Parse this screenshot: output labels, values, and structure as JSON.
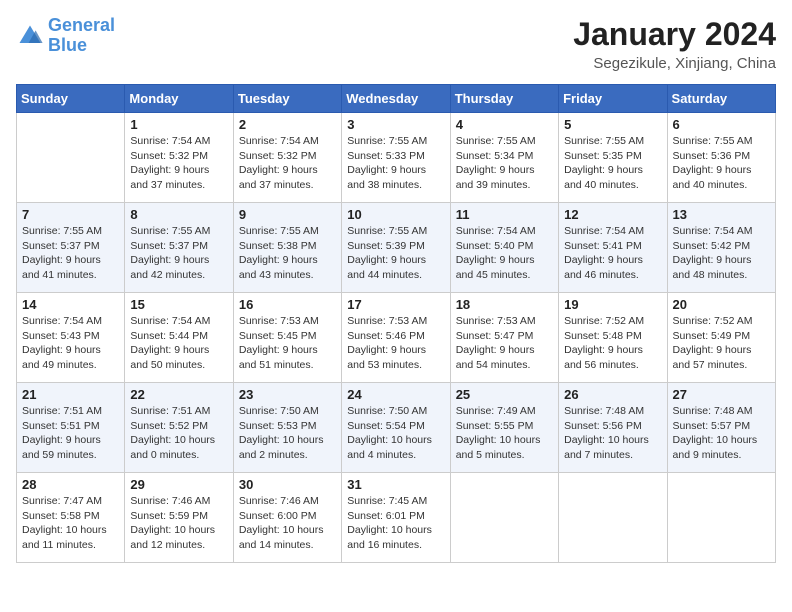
{
  "logo": {
    "line1": "General",
    "line2": "Blue"
  },
  "title": "January 2024",
  "subtitle": "Segezikule, Xinjiang, China",
  "weekdays": [
    "Sunday",
    "Monday",
    "Tuesday",
    "Wednesday",
    "Thursday",
    "Friday",
    "Saturday"
  ],
  "weeks": [
    [
      {
        "day": "",
        "info": ""
      },
      {
        "day": "1",
        "info": "Sunrise: 7:54 AM\nSunset: 5:32 PM\nDaylight: 9 hours\nand 37 minutes."
      },
      {
        "day": "2",
        "info": "Sunrise: 7:54 AM\nSunset: 5:32 PM\nDaylight: 9 hours\nand 37 minutes."
      },
      {
        "day": "3",
        "info": "Sunrise: 7:55 AM\nSunset: 5:33 PM\nDaylight: 9 hours\nand 38 minutes."
      },
      {
        "day": "4",
        "info": "Sunrise: 7:55 AM\nSunset: 5:34 PM\nDaylight: 9 hours\nand 39 minutes."
      },
      {
        "day": "5",
        "info": "Sunrise: 7:55 AM\nSunset: 5:35 PM\nDaylight: 9 hours\nand 40 minutes."
      },
      {
        "day": "6",
        "info": "Sunrise: 7:55 AM\nSunset: 5:36 PM\nDaylight: 9 hours\nand 40 minutes."
      }
    ],
    [
      {
        "day": "7",
        "info": "Sunrise: 7:55 AM\nSunset: 5:37 PM\nDaylight: 9 hours\nand 41 minutes."
      },
      {
        "day": "8",
        "info": "Sunrise: 7:55 AM\nSunset: 5:37 PM\nDaylight: 9 hours\nand 42 minutes."
      },
      {
        "day": "9",
        "info": "Sunrise: 7:55 AM\nSunset: 5:38 PM\nDaylight: 9 hours\nand 43 minutes."
      },
      {
        "day": "10",
        "info": "Sunrise: 7:55 AM\nSunset: 5:39 PM\nDaylight: 9 hours\nand 44 minutes."
      },
      {
        "day": "11",
        "info": "Sunrise: 7:54 AM\nSunset: 5:40 PM\nDaylight: 9 hours\nand 45 minutes."
      },
      {
        "day": "12",
        "info": "Sunrise: 7:54 AM\nSunset: 5:41 PM\nDaylight: 9 hours\nand 46 minutes."
      },
      {
        "day": "13",
        "info": "Sunrise: 7:54 AM\nSunset: 5:42 PM\nDaylight: 9 hours\nand 48 minutes."
      }
    ],
    [
      {
        "day": "14",
        "info": "Sunrise: 7:54 AM\nSunset: 5:43 PM\nDaylight: 9 hours\nand 49 minutes."
      },
      {
        "day": "15",
        "info": "Sunrise: 7:54 AM\nSunset: 5:44 PM\nDaylight: 9 hours\nand 50 minutes."
      },
      {
        "day": "16",
        "info": "Sunrise: 7:53 AM\nSunset: 5:45 PM\nDaylight: 9 hours\nand 51 minutes."
      },
      {
        "day": "17",
        "info": "Sunrise: 7:53 AM\nSunset: 5:46 PM\nDaylight: 9 hours\nand 53 minutes."
      },
      {
        "day": "18",
        "info": "Sunrise: 7:53 AM\nSunset: 5:47 PM\nDaylight: 9 hours\nand 54 minutes."
      },
      {
        "day": "19",
        "info": "Sunrise: 7:52 AM\nSunset: 5:48 PM\nDaylight: 9 hours\nand 56 minutes."
      },
      {
        "day": "20",
        "info": "Sunrise: 7:52 AM\nSunset: 5:49 PM\nDaylight: 9 hours\nand 57 minutes."
      }
    ],
    [
      {
        "day": "21",
        "info": "Sunrise: 7:51 AM\nSunset: 5:51 PM\nDaylight: 9 hours\nand 59 minutes."
      },
      {
        "day": "22",
        "info": "Sunrise: 7:51 AM\nSunset: 5:52 PM\nDaylight: 10 hours\nand 0 minutes."
      },
      {
        "day": "23",
        "info": "Sunrise: 7:50 AM\nSunset: 5:53 PM\nDaylight: 10 hours\nand 2 minutes."
      },
      {
        "day": "24",
        "info": "Sunrise: 7:50 AM\nSunset: 5:54 PM\nDaylight: 10 hours\nand 4 minutes."
      },
      {
        "day": "25",
        "info": "Sunrise: 7:49 AM\nSunset: 5:55 PM\nDaylight: 10 hours\nand 5 minutes."
      },
      {
        "day": "26",
        "info": "Sunrise: 7:48 AM\nSunset: 5:56 PM\nDaylight: 10 hours\nand 7 minutes."
      },
      {
        "day": "27",
        "info": "Sunrise: 7:48 AM\nSunset: 5:57 PM\nDaylight: 10 hours\nand 9 minutes."
      }
    ],
    [
      {
        "day": "28",
        "info": "Sunrise: 7:47 AM\nSunset: 5:58 PM\nDaylight: 10 hours\nand 11 minutes."
      },
      {
        "day": "29",
        "info": "Sunrise: 7:46 AM\nSunset: 5:59 PM\nDaylight: 10 hours\nand 12 minutes."
      },
      {
        "day": "30",
        "info": "Sunrise: 7:46 AM\nSunset: 6:00 PM\nDaylight: 10 hours\nand 14 minutes."
      },
      {
        "day": "31",
        "info": "Sunrise: 7:45 AM\nSunset: 6:01 PM\nDaylight: 10 hours\nand 16 minutes."
      },
      {
        "day": "",
        "info": ""
      },
      {
        "day": "",
        "info": ""
      },
      {
        "day": "",
        "info": ""
      }
    ]
  ]
}
